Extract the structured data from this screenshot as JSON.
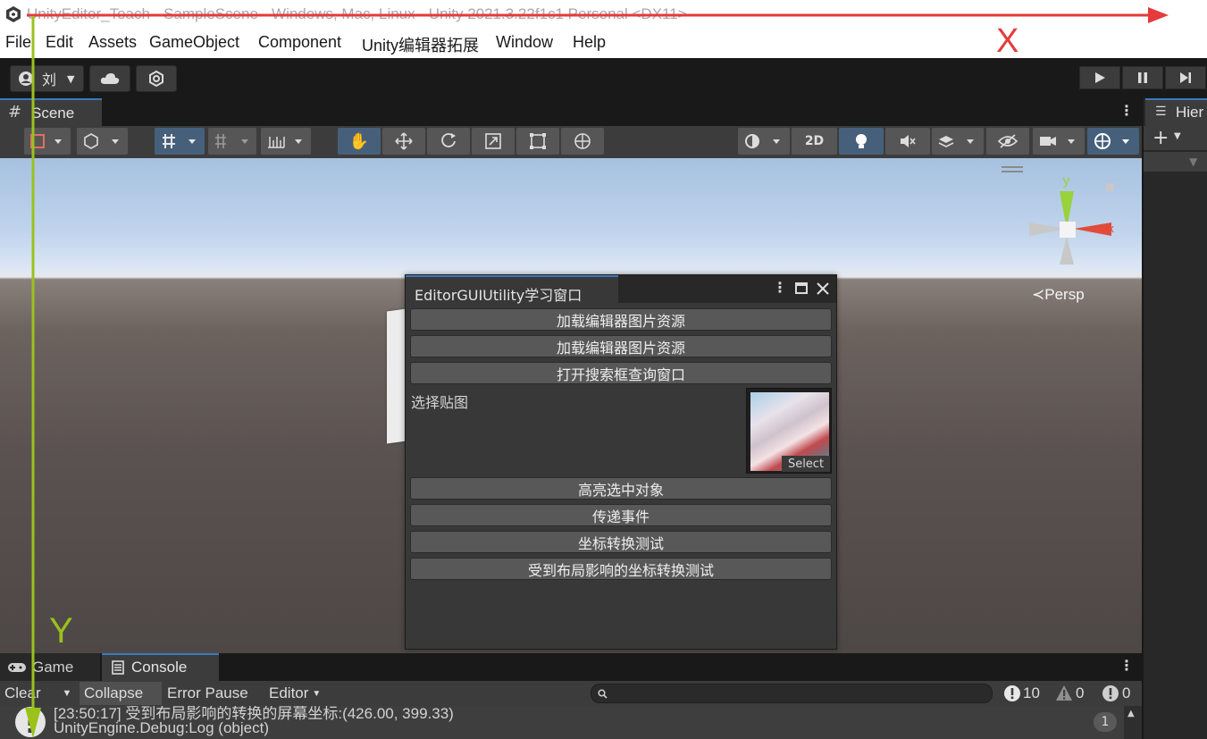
{
  "window": {
    "title": "UnityEditor_Teach - SampleScene - Windows, Mac, Linux - Unity 2021.3.22f1c1 Personal <DX11>"
  },
  "menu": [
    "File",
    "Edit",
    "Assets",
    "GameObject",
    "Component",
    "Unity编辑器拓展",
    "Window",
    "Help"
  ],
  "toolbar": {
    "account_label": "刘"
  },
  "scene": {
    "tab_label": "Scene",
    "btn_2d": "2D",
    "persp_label": "≺Persp",
    "gizmo_y": "y",
    "gizmo_x": "x"
  },
  "hierarchy": {
    "tab_label": "Hier"
  },
  "editor_window": {
    "tab_label": "EditorGUIUtility学习窗口",
    "buttons": [
      "加载编辑器图片资源",
      "加载编辑器图片资源",
      "打开搜索框查询窗口"
    ],
    "texture_label": "选择贴图",
    "texture_select": "Select",
    "buttons2": [
      "高亮选中对象",
      "传递事件",
      "坐标转换测试",
      "受到布局影响的坐标转换测试"
    ]
  },
  "console": {
    "game_tab": "Game",
    "console_tab": "Console",
    "clear": "Clear",
    "collapse": "Collapse",
    "error_pause": "Error Pause",
    "editor": "Editor",
    "count_info": "10",
    "count_warn": "0",
    "count_error": "0",
    "log_line1": "[23:50:17] 受到布局影响的转换的屏幕坐标:(426.00, 399.33)",
    "log_line2": "UnityEngine.Debug:Log (object)",
    "log_count": "1"
  },
  "annotations": {
    "x_label": "X",
    "y_label": "Y",
    "x_color": "#e53b3b",
    "y_color": "#9ac21b"
  }
}
